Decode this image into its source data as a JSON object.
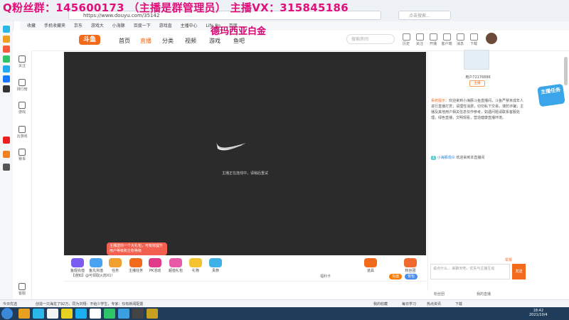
{
  "overlay": {
    "fan_group": "Q粉丝群：145600173 （主播是群管理员）  主播VX：315845186",
    "watermark": "德玛西亚白金"
  },
  "browser": {
    "url": "https://www.douyu.com/35142",
    "search_placeholder": "点击搜索...",
    "bookmarks": [
      "收藏",
      "手机收藏夹",
      "京东",
      "游戏大",
      "小海豚",
      "百度一下",
      "游戏直",
      "主播中心",
      "Life Ro",
      "百度"
    ]
  },
  "sidebar_douyu": {
    "items": [
      "关注",
      "排行榜",
      "游戏",
      "云游戏",
      "赛事",
      "客服"
    ]
  },
  "header": {
    "logo": "斗鱼",
    "nav": [
      "首页",
      "直播",
      "分类",
      "视频",
      "游戏",
      "鱼吧"
    ],
    "search_placeholder": "搜索房间",
    "icons": [
      "历史",
      "关注",
      "开播",
      "客户端",
      "消息",
      "下载"
    ]
  },
  "player": {
    "message": "主播正在连线中，请稍后重试"
  },
  "promo_popup": {
    "text": "主播送你一个大礼包，可有效提升用户等级和主粉等级"
  },
  "toolbar": {
    "items": [
      "鱼翅充值",
      "鱼丸充值",
      "任务",
      "主播任务",
      "PK活动",
      "超值礼包",
      "礼物",
      "贵族",
      "道具",
      "粉丝团"
    ],
    "bottom_left": "【通知】@可领取火箭X1！",
    "room_text": "福利卡",
    "btn1": "充值",
    "btn2": "背包"
  },
  "anchor": {
    "name": "用户72176886",
    "rank": "主播"
  },
  "chat": {
    "system_tag": "系统提示：",
    "system_text": "欢迎来到小海豚斗鱼直播间，斗鱼严禁未成年人进行直播打赏；请理性消费，切勿私下交易，谨防诈骗；主播及其他用户相关信息仅作参考，如遇问题请联系客服处理，绿色直播，文明观看，营造健康直播环境。",
    "user_level": "1",
    "user_name": "小海豚观众",
    "user_text": "欢迎来到本直播间",
    "input_placeholder": "说点什么... 来聊天吧，优先与主播互动",
    "send": "发送",
    "report": "举报",
    "fanclub": "粉丝团",
    "mylive": "我的直播"
  },
  "side_badge": "主播任务",
  "statusbar": {
    "left": "今日优选",
    "news": "创造一只海龙了92万，同为刘翔：不给少学生，专家：仅有新闻配置",
    "right": [
      "我的收藏",
      "每日学习",
      "热点资讯",
      "下载"
    ]
  },
  "clock": {
    "time": "18:42",
    "date": "2021/10/4"
  }
}
